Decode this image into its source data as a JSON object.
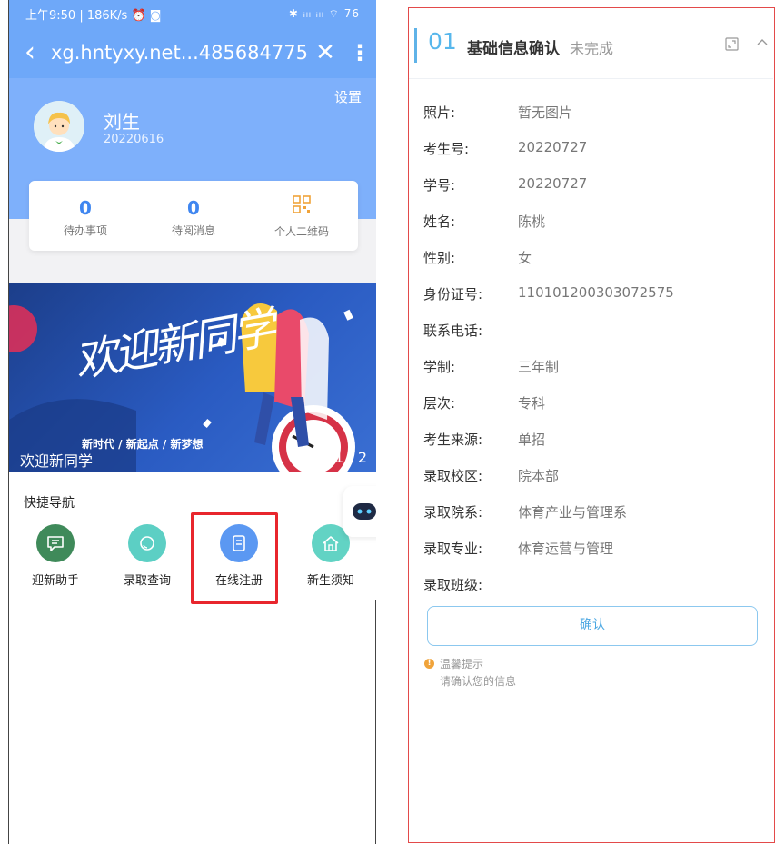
{
  "phone": {
    "status_bar": {
      "left": "上午9:50 | 186K/s ⏰ ◙",
      "right": "✱ ᵢₗₗ ᵢₗₗ ⌔ 76"
    },
    "nav": {
      "back": "‹",
      "url": "xg.hntyxy.net...4856847756",
      "close": "✕",
      "more": "⋮"
    },
    "profile": {
      "settings": "设置",
      "name": "刘生",
      "id": "20220616"
    },
    "stats": [
      {
        "value": "0",
        "label": "待办事项"
      },
      {
        "value": "0",
        "label": "待阅消息"
      },
      {
        "label": "个人二维码",
        "icon": "qr-code-icon"
      }
    ],
    "banner": {
      "art_title": "欢迎新同学",
      "subtitle": "新时代 / 新起点 / 新梦想",
      "caption": "欢迎新同学",
      "page": "1 / 2"
    },
    "quick_nav": {
      "title": "快捷导航",
      "items": [
        {
          "label": "迎新助手",
          "icon": "chat-icon",
          "color": "#3f8a5a"
        },
        {
          "label": "录取查询",
          "icon": "search-icon",
          "color": "#5ccfc4"
        },
        {
          "label": "在线注册",
          "icon": "document-icon",
          "color": "#5b98f2"
        },
        {
          "label": "新生须知",
          "icon": "home-icon",
          "color": "#62d3c4"
        }
      ]
    }
  },
  "panel": {
    "number": "01",
    "title": "基础信息确认",
    "status": "未完成",
    "rows": [
      {
        "label": "照片:",
        "value": "暂无图片"
      },
      {
        "label": "考生号:",
        "value": "20220727"
      },
      {
        "label": "学号:",
        "value": "20220727"
      },
      {
        "label": "姓名:",
        "value": "陈桃"
      },
      {
        "label": "性别:",
        "value": "女"
      },
      {
        "label": "身份证号:",
        "value": "110101200303072575"
      },
      {
        "label": "联系电话:",
        "value": ""
      },
      {
        "label": "学制:",
        "value": "三年制"
      },
      {
        "label": "层次:",
        "value": "专科"
      },
      {
        "label": "考生来源:",
        "value": "单招"
      },
      {
        "label": "录取校区:",
        "value": "院本部"
      },
      {
        "label": "录取院系:",
        "value": "体育产业与管理系"
      },
      {
        "label": "录取专业:",
        "value": "体育运营与管理"
      },
      {
        "label": "录取班级:",
        "value": ""
      }
    ],
    "confirm": "确认",
    "tip_title": "温馨提示",
    "tip_text": "请确认您的信息"
  }
}
